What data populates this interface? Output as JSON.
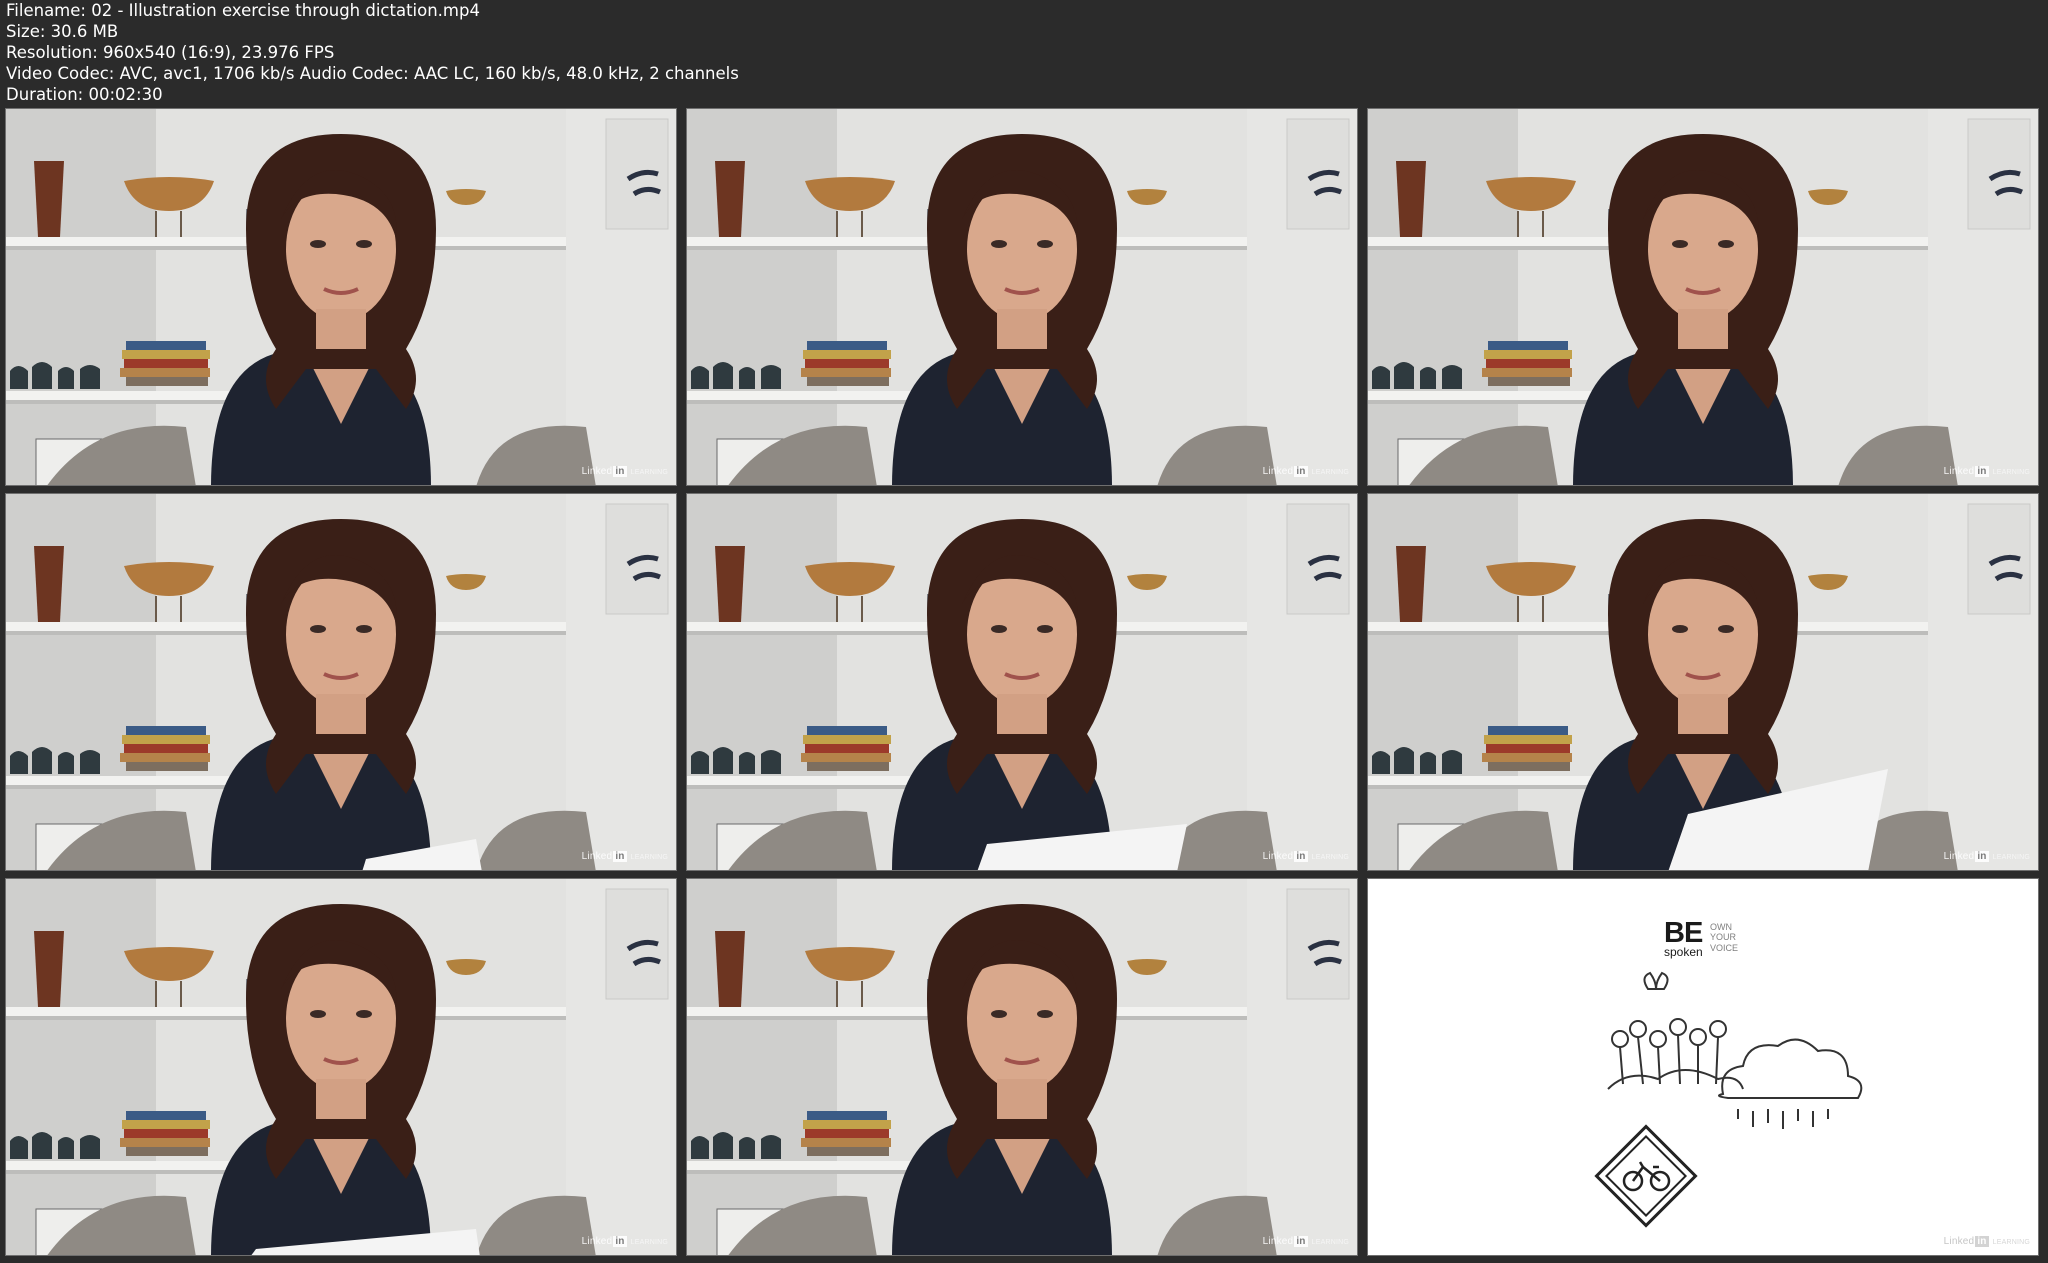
{
  "header": {
    "filename": "Filename: 02 - Illustration exercise through dictation.mp4",
    "size": "Size: 30.6 MB",
    "resolution": "Resolution: 960x540 (16:9), 23.976 FPS",
    "codec": "Video Codec: AVC, avc1, 1706 kb/s Audio Codec: AAC LC, 160 kb/s, 48.0 kHz, 2 channels",
    "duration": "Duration: 00:02:30"
  },
  "watermark": {
    "text": "Linked",
    "in": "in",
    "sub": "LEARNING"
  },
  "slide": {
    "title": "BE",
    "subtitle": "spoken",
    "tag_own": "OWN",
    "tag_your": "YOUR",
    "tag_voice": "VOICE"
  },
  "colors": {
    "background": "#2b2b2b",
    "header_text": "#ffffff",
    "wall": "#dcdcda",
    "dress": "#1e2330",
    "hair": "#3a1f17",
    "skin": "#d9a88c"
  },
  "icons": [
    "flowers-icon",
    "rain-cloud-icon",
    "bicycle-sign-icon"
  ]
}
